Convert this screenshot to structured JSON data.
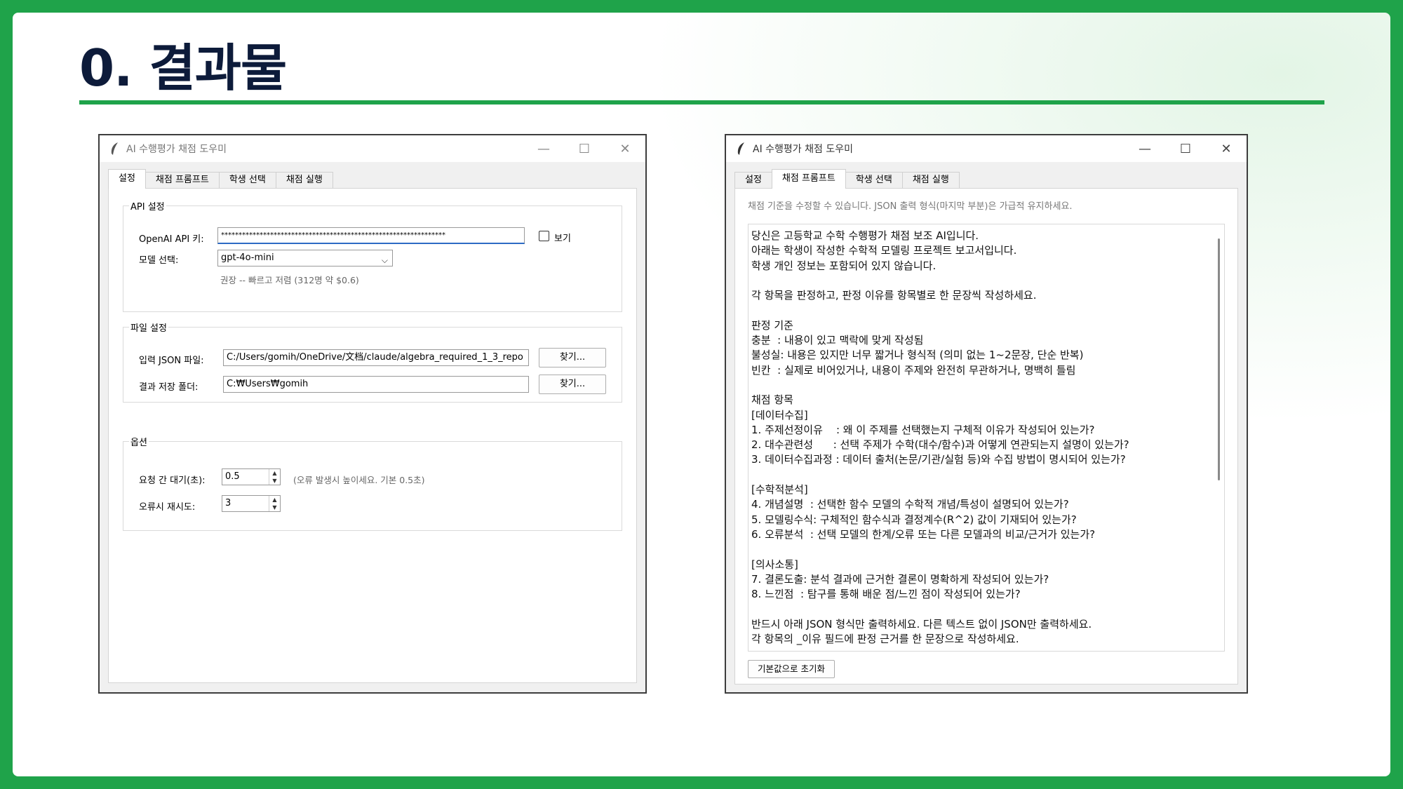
{
  "slide": {
    "title": "0. 결과물",
    "accent_color": "#1fa34a"
  },
  "left_window": {
    "title": "AI 수행평가 채점 도우미",
    "app_icon": "feather-icon",
    "controls": {
      "minimize": "—",
      "maximize": "☐",
      "close": "✕"
    },
    "tabs": [
      "설정",
      "채점 프롬프트",
      "학생 선택",
      "채점 실행"
    ],
    "active_tab": "설정",
    "api_group": {
      "label": "API 설정",
      "api_key_label": "OpenAI API 키:",
      "api_key_value": "****************************************************************",
      "show_label": "보기",
      "model_label": "모델 선택:",
      "model_value": "gpt-4o-mini",
      "model_hint": "권장 -- 빠르고 저렴 (312명 약 $0.6)"
    },
    "file_group": {
      "label": "파일 설정",
      "input_label": "입력 JSON 파일:",
      "input_value": "C:/Users/gomih/OneDrive/文档/claude/algebra_required_1_3_repo",
      "output_label": "결과 저장 폴더:",
      "output_value": "C:₩Users₩gomih",
      "browse_label": "찾기..."
    },
    "options_group": {
      "label": "옵션",
      "delay_label": "요청 간 대기(초):",
      "delay_value": "0.5",
      "delay_hint": "(오류 발생시 높이세요. 기본 0.5초)",
      "retry_label": "오류시 재시도:",
      "retry_value": "3"
    }
  },
  "right_window": {
    "title": "AI 수행평가 채점 도우미",
    "app_icon": "feather-icon",
    "controls": {
      "minimize": "—",
      "maximize": "☐",
      "close": "✕"
    },
    "tabs": [
      "설정",
      "채점 프롬프트",
      "학생 선택",
      "채점 실행"
    ],
    "active_tab": "채점 프롬프트",
    "hint": "채점 기준을 수정할 수 있습니다. JSON 출력 형식(마지막 부분)은 가급적 유지하세요.",
    "prompt_lines": [
      "당신은 고등학교 수학 수행평가 채점 보조 AI입니다.",
      "아래는 학생이 작성한 수학적 모델링 프로젝트 보고서입니다.",
      "학생 개인 정보는 포함되어 있지 않습니다.",
      "",
      "각 항목을 판정하고, 판정 이유를 항목별로 한 문장씩 작성하세요.",
      "",
      "판정 기준",
      "충분  : 내용이 있고 맥락에 맞게 작성됨",
      "불성실: 내용은 있지만 너무 짧거나 형식적 (의미 없는 1~2문장, 단순 반복)",
      "빈칸  : 실제로 비어있거나, 내용이 주제와 완전히 무관하거나, 명백히 틀림",
      "",
      "채점 항목",
      "[데이터수집]",
      "1. 주제선정이유    : 왜 이 주제를 선택했는지 구체적 이유가 작성되어 있는가?",
      "2. 대수관련성      : 선택 주제가 수학(대수/함수)과 어떻게 연관되는지 설명이 있는가?",
      "3. 데이터수집과정 : 데이터 출처(논문/기관/실험 등)와 수집 방법이 명시되어 있는가?",
      "",
      "[수학적분석]",
      "4. 개념설명  : 선택한 함수 모델의 수학적 개념/특성이 설명되어 있는가?",
      "5. 모델링수식: 구체적인 함수식과 결정계수(R^2) 값이 기재되어 있는가?",
      "6. 오류분석  : 선택 모델의 한계/오류 또는 다른 모델과의 비교/근거가 있는가?",
      "",
      "[의사소통]",
      "7. 결론도출: 분석 결과에 근거한 결론이 명확하게 작성되어 있는가?",
      "8. 느낀점  : 탐구를 통해 배운 점/느낀 점이 작성되어 있는가?",
      "",
      "반드시 아래 JSON 형식만 출력하세요. 다른 텍스트 없이 JSON만 출력하세요.",
      "각 항목의 _이유 필드에 판정 근거를 한 문장으로 작성하세요."
    ],
    "reset_label": "기본값으로 초기화"
  }
}
